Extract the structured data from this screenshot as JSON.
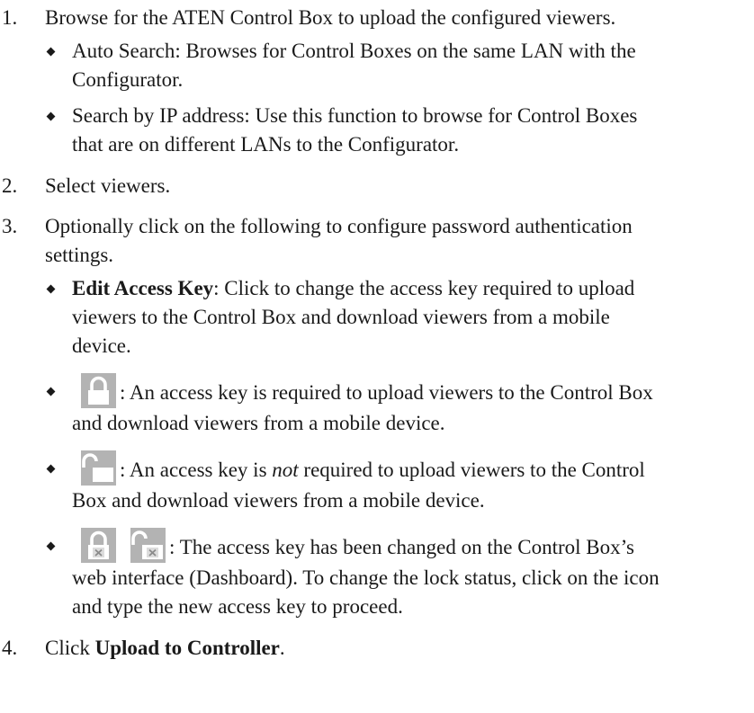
{
  "steps": {
    "s1": {
      "num": "1.",
      "text": "Browse for the ATEN Control Box to upload the configured viewers.",
      "bullets": {
        "b1": {
          "line1": "Auto Search: Browses for Control Boxes on the same LAN with the",
          "line2": "Configurator."
        },
        "b2": {
          "line1": "Search by IP address: Use this function to browse for Control Boxes",
          "line2": "that are on different LANs to the Configurator."
        }
      }
    },
    "s2": {
      "num": "2.",
      "text": "Select viewers."
    },
    "s3": {
      "num": "3.",
      "line1": "Optionally click on the following to configure password authentication",
      "line2": "settings.",
      "edit_access_key": {
        "label": "Edit Access Key",
        "line1_rest": ": Click to change the access key required to upload",
        "line2": "viewers to the Control Box and download viewers from a mobile",
        "line3": "device."
      },
      "locked": {
        "icon": "lock-closed-icon",
        "line1": ": An access key is required to upload viewers to the Control Box",
        "line2": "and download viewers from a mobile device."
      },
      "unlocked": {
        "icon": "lock-open-icon",
        "line1_pre": ": An access key is ",
        "emphasis": "not",
        "line1_post": " required to upload viewers to the Control",
        "line2": "Box and download viewers from a mobile device."
      },
      "changed": {
        "icons": [
          "lock-closed-error-icon",
          "lock-open-error-icon"
        ],
        "line1": ": The access key has been changed on the Control Box’s",
        "line2": "web interface (Dashboard). To change the lock status, click on the icon",
        "line3": "and type the new access key to proceed."
      }
    },
    "s4": {
      "num": "4.",
      "pre": "Click ",
      "bold": "Upload to Controller",
      "post": "."
    }
  },
  "colors": {
    "text": "#1a1a1a",
    "icon_bg": "#b3b3b3",
    "icon_fg": "#ffffff",
    "icon_x_bg": "#dcdcdc",
    "icon_x": "#8a8a8a"
  }
}
